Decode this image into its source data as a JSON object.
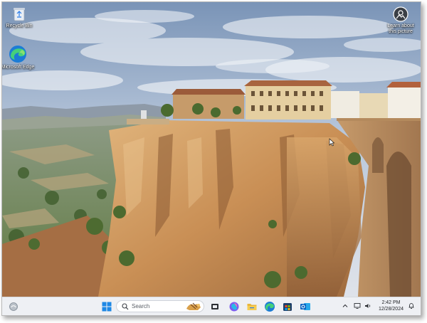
{
  "desktop": {
    "icons": [
      {
        "label": "Recycle Bin",
        "icon": "recycle-bin-icon"
      },
      {
        "label": "Microsoft Edge",
        "icon": "edge-icon"
      },
      {
        "label": "Learn about this picture",
        "icon": "camera-icon"
      }
    ]
  },
  "taskbar": {
    "search_placeholder": "Search",
    "pinned_apps": [
      "start-icon",
      "search-icon",
      "copilot-icon",
      "task-view-icon",
      "photos-icon",
      "file-explorer-icon",
      "edge-icon",
      "store-icon",
      "outlook-icon"
    ],
    "time": "2:42 PM",
    "date": "12/28/2024"
  },
  "colors": {
    "taskbar_bg": "#eef0f4",
    "start_blue": "#1e88e5",
    "edge_green": "#2fbf71"
  }
}
